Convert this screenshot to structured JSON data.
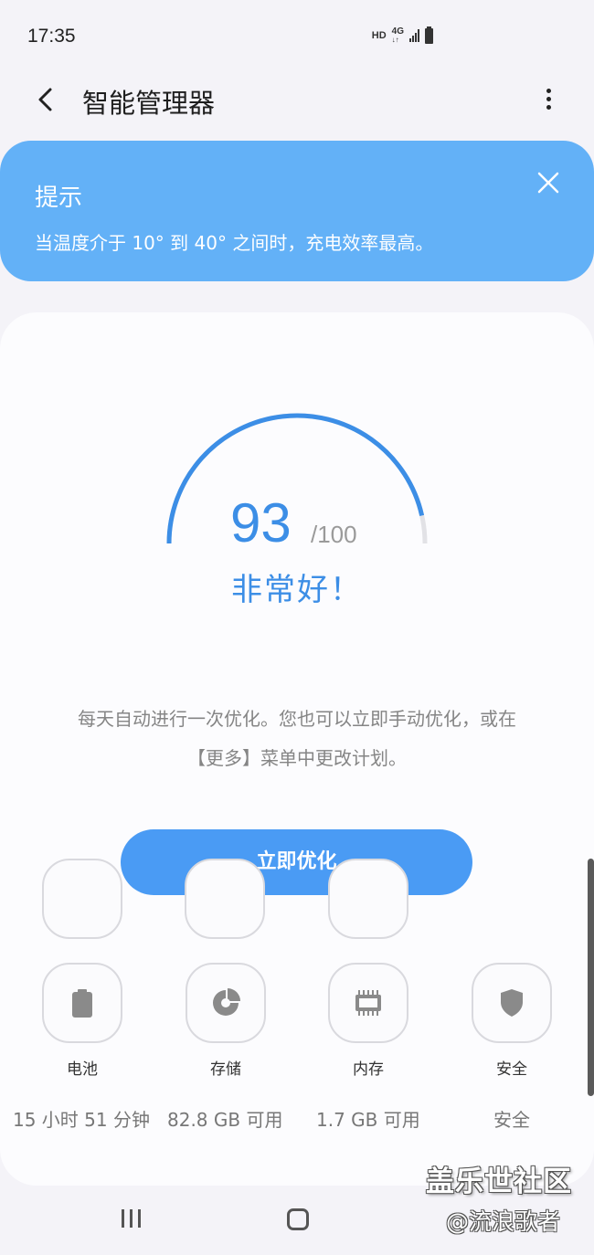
{
  "status_bar": {
    "time": "17:35",
    "hd": "HD",
    "network": "4G"
  },
  "app_bar": {
    "title": "智能管理器"
  },
  "tip": {
    "title": "提示",
    "text": "当温度介于 10° 到 40° 之间时，充电效率最高。"
  },
  "score": {
    "value": "93",
    "max": "/100",
    "fraction": 0.93,
    "label": "非常好！",
    "accent_color": "#3c8ee6",
    "track_color": "#e2e2e6"
  },
  "description": {
    "line1": "每天自动进行一次优化。您也可以立即手动优化，或在",
    "line2": "【更多】菜单中更改计划。"
  },
  "optimize_button": {
    "label": "立即优化",
    "color": "#4a9bf4"
  },
  "tiles": [
    {
      "icon": "battery-icon",
      "name": "电池",
      "stat": "15 小时 51 分钟"
    },
    {
      "icon": "storage-icon",
      "name": "存储",
      "stat": "82.8 GB 可用"
    },
    {
      "icon": "memory-icon",
      "name": "内存",
      "stat": "1.7 GB 可用"
    },
    {
      "icon": "security-icon",
      "name": "安全",
      "stat": "安全"
    }
  ],
  "watermark": {
    "line1": "盖乐世社区",
    "line2": "@流浪歌者"
  }
}
